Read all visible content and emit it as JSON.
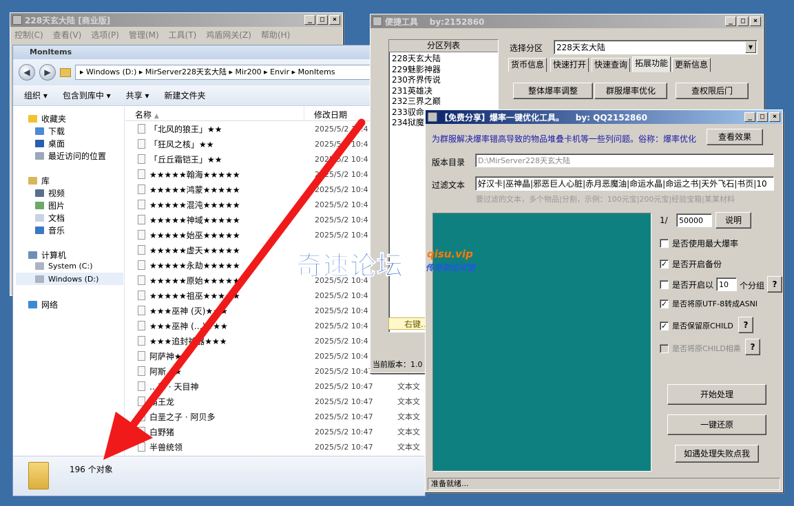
{
  "back_window": {
    "title": "228天玄大陆 [商业版]",
    "menu": [
      "控制(C)",
      "查看(V)",
      "选项(P)",
      "管理(M)",
      "工具(T)",
      "鸡盾网关(Z)",
      "帮助(H)"
    ]
  },
  "explorer": {
    "title": "MonItems",
    "breadcrumb": "▸ Windows (D:) ▸ MirServer228天玄大陆 ▸ Mir200 ▸ Envir ▸ MonItems",
    "toolbar": [
      "组织 ▾",
      "包含到库中 ▾",
      "共享 ▾",
      "新建文件夹"
    ],
    "nav": {
      "favorites": "收藏夹",
      "downloads": "下载",
      "desktop": "桌面",
      "recent": "最近访问的位置",
      "libraries": "库",
      "videos": "视频",
      "pictures": "图片",
      "documents": "文档",
      "music": "音乐",
      "computer": "计算机",
      "drive_c": "System (C:)",
      "drive_d": "Windows (D:)",
      "network": "网络"
    },
    "columns": {
      "name": "名称",
      "modified": "修改日期"
    },
    "files": [
      {
        "name": "「北风的狼王」★★",
        "date": "2025/5/2 10:4",
        "type": ""
      },
      {
        "name": "「狂风之核」★★",
        "date": "2025/5/2 10:4",
        "type": ""
      },
      {
        "name": "「丘丘霜铠王」★★",
        "date": "2025/5/2 10:4",
        "type": ""
      },
      {
        "name": "★★★★★翰海★★★★★",
        "date": "2025/5/2 10:4",
        "type": ""
      },
      {
        "name": "★★★★★鸿蒙★★★★★",
        "date": "2025/5/2 10:4",
        "type": ""
      },
      {
        "name": "★★★★★混沌★★★★★",
        "date": "2025/5/2 10:4",
        "type": ""
      },
      {
        "name": "★★★★★神域★★★★★",
        "date": "2025/5/2 10:4",
        "type": ""
      },
      {
        "name": "★★★★★始巫★★★★★",
        "date": "2025/5/2 10:4",
        "type": ""
      },
      {
        "name": "★★★★★虚天★★★★★",
        "date": "",
        "type": ""
      },
      {
        "name": "★★★★★永劫★★★★★",
        "date": "",
        "type": ""
      },
      {
        "name": "★★★★★原始★★★★★",
        "date": "2025/5/2 10:4",
        "type": ""
      },
      {
        "name": "★★★★★祖巫★★★★★",
        "date": "2025/5/2 10:4",
        "type": ""
      },
      {
        "name": "★★★巫神 (灭)★★★",
        "date": "2025/5/2 10:4",
        "type": ""
      },
      {
        "name": "★★★巫神 (…)★★★",
        "date": "2025/5/2 10:4",
        "type": ""
      },
      {
        "name": "★★★追封神器★★★",
        "date": "2025/5/2 10:4",
        "type": ""
      },
      {
        "name": "阿萨神★★",
        "date": "2025/5/2 10:4",
        "type": ""
      },
      {
        "name": "阿斯…★",
        "date": "2025/5/2 10:47",
        "type": "文本文"
      },
      {
        "name": "…部 · 天目神",
        "date": "2025/5/2 10:47",
        "type": "文本文"
      },
      {
        "name": "霸王龙",
        "date": "2025/5/2 10:47",
        "type": "文本文"
      },
      {
        "name": "白垩之子 · 阿贝多",
        "date": "2025/5/2 10:47",
        "type": "文本文"
      },
      {
        "name": "白野猪",
        "date": "2025/5/2 10:47",
        "type": "文本文"
      },
      {
        "name": "半兽统领",
        "date": "2025/5/2 10:47",
        "type": "文本文"
      }
    ],
    "status": "196 个对象"
  },
  "quick_tool": {
    "title": "便捷工具",
    "author": "by:2152860",
    "partition_header": "分区列表",
    "partitions": [
      "228天玄大陆",
      "229魅影神器",
      "230齐界传说",
      "231英雄决",
      "232三界之巅",
      "233驭命…",
      "234狱魔…"
    ],
    "select_label": "选择分区",
    "selected_partition": "228天玄大陆",
    "tabs": [
      "货币信息",
      "快速打开",
      "快速查询",
      "拓展功能",
      "更新信息"
    ],
    "buttons": [
      "整体爆率调整",
      "群服爆率优化",
      "查权限后门"
    ],
    "right_hint": "右键…",
    "version": "当前版本：1.0"
  },
  "optimizer": {
    "title": "【免费分享】爆率一键优化工具。",
    "author": "by: QQ2152860",
    "description": "为群服解决爆率错高导致的物品堆叠卡机等一些列问题。俗称：爆率优化",
    "view_effect": "查看效果",
    "dir_label": "版本目录",
    "dir_value": "D:\\MirServer228天玄大陆",
    "filter_label": "过滤文本",
    "filter_value": "好汉卡|巫神晶|邪恶巨人心脏|赤月恶魔油|命运水晶|命运之书|天外飞石|书页|10",
    "filter_hint": "要过滤的文本，多个物品|分割，示例：100元宝|200元宝|经验宝箱|某某材料",
    "ratio_prefix": "1/",
    "ratio_value": "50000",
    "explain": "说明",
    "opt_max": "是否使用最大爆率",
    "opt_backup": "是否开启备份",
    "opt_group_prefix": "是否开启以",
    "opt_group_value": "10",
    "opt_group_suffix": "个分组",
    "opt_utf8": "是否将原UTF-8转成ASNI",
    "opt_child": "是否保留原CHILD",
    "opt_child_merge": "是否将原CHILD相乘",
    "help": "?",
    "start": "开始处理",
    "restore": "一键还原",
    "fail": "如遇处理失败点我",
    "status": "准备就绪..."
  },
  "watermark": {
    "main": "奇速论坛",
    "site": "qisu.vip",
    "slogan": "传奇架设试错"
  }
}
